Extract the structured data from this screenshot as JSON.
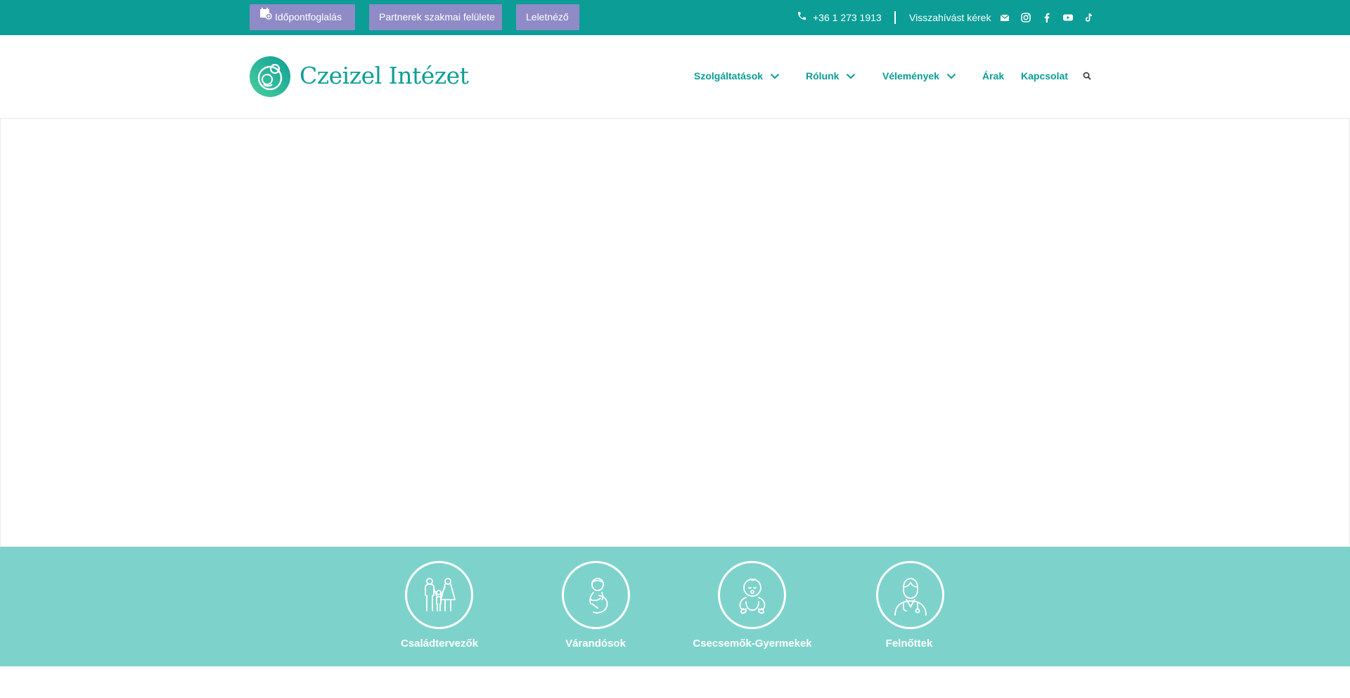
{
  "topbar": {
    "buttons": [
      {
        "label": "Időpontfoglalás",
        "icon": "calendar-plus-icon"
      },
      {
        "label": "Partnerek szakmai felülete"
      },
      {
        "label": "Leletnéző"
      }
    ],
    "phone": "+36 1 273 1913",
    "callback": "Visszahívást kérek",
    "social_icons": [
      "mail-icon",
      "instagram-icon",
      "facebook-icon",
      "youtube-icon",
      "tiktok-icon"
    ]
  },
  "header": {
    "logo_text": "Czeizel Intézet",
    "nav": [
      {
        "label": "Szolgáltatások",
        "dropdown": true
      },
      {
        "label": "Rólunk",
        "dropdown": true
      },
      {
        "label": "Vélemények",
        "dropdown": true
      },
      {
        "label": "Árak",
        "dropdown": false
      },
      {
        "label": "Kapcsolat",
        "dropdown": false
      }
    ]
  },
  "categories": [
    {
      "label": "Családtervezők",
      "icon": "family-icon"
    },
    {
      "label": "Várandósok",
      "icon": "pregnant-woman-icon"
    },
    {
      "label": "Csecsemők-Gyermekek",
      "icon": "baby-icon"
    },
    {
      "label": "Felnőttek",
      "icon": "doctor-icon"
    }
  ],
  "colors": {
    "topbar_bg": "#0b9d96",
    "button_bg": "#8e8bc6",
    "brand_teal": "#0e9e97",
    "band_bg": "#7dd3cb"
  }
}
